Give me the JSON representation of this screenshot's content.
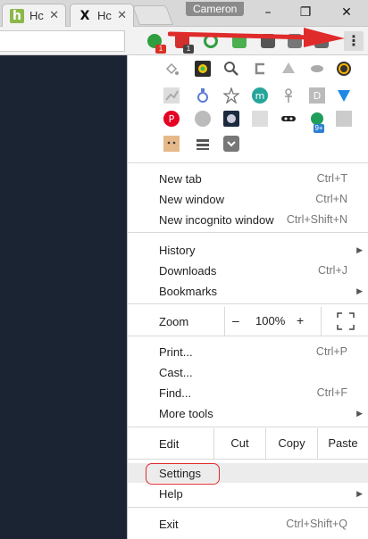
{
  "browser": {
    "tabs": [
      {
        "label": "Hc",
        "favicon": "howtogeek-h-icon"
      },
      {
        "label": "Hc",
        "favicon": "x-logo-icon"
      }
    ],
    "profile_name": "Cameron",
    "window_controls": {
      "minimize": "–",
      "maximize": "❐",
      "close": "✕"
    },
    "extension_badges": {
      "first": "1",
      "second": "1"
    },
    "menu_button_glyph": "⋮"
  },
  "menu": {
    "new_tab": {
      "label": "New tab",
      "shortcut": "Ctrl+T"
    },
    "new_window": {
      "label": "New window",
      "shortcut": "Ctrl+N"
    },
    "new_incognito": {
      "label": "New incognito window",
      "shortcut": "Ctrl+Shift+N"
    },
    "history": {
      "label": "History"
    },
    "downloads": {
      "label": "Downloads",
      "shortcut": "Ctrl+J"
    },
    "bookmarks": {
      "label": "Bookmarks"
    },
    "zoom": {
      "label": "Zoom",
      "minus": "–",
      "value": "100%",
      "plus": "+"
    },
    "print": {
      "label": "Print...",
      "shortcut": "Ctrl+P"
    },
    "cast": {
      "label": "Cast..."
    },
    "find": {
      "label": "Find...",
      "shortcut": "Ctrl+F"
    },
    "more_tools": {
      "label": "More tools"
    },
    "edit": {
      "label": "Edit",
      "cut": "Cut",
      "copy": "Copy",
      "paste": "Paste"
    },
    "settings": {
      "label": "Settings"
    },
    "help": {
      "label": "Help"
    },
    "exit": {
      "label": "Exit",
      "shortcut": "Ctrl+Shift+Q"
    },
    "extension_badge": "9+"
  },
  "colors": {
    "annotation_red": "#e02b2b",
    "page_background": "#1b2433",
    "settings_highlight": "#ececec"
  }
}
